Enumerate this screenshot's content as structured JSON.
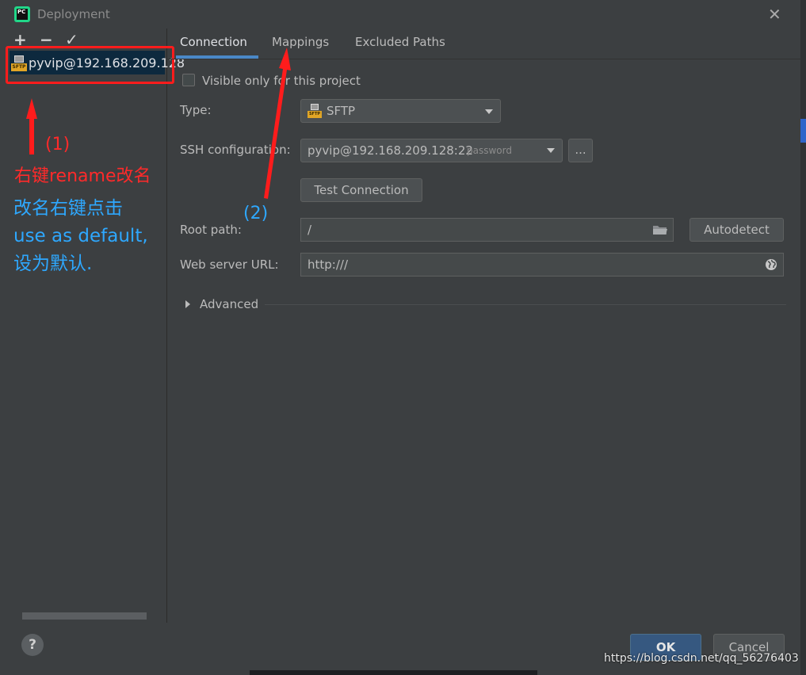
{
  "window": {
    "title": "Deployment",
    "app_icon_text": "PC"
  },
  "left_toolbar": {
    "add": "+",
    "remove": "−",
    "default": "✓"
  },
  "servers": [
    {
      "label": "pyvip@192.168.209.128",
      "badge": "SFTP"
    }
  ],
  "tabs": [
    {
      "label": "Connection",
      "active": true
    },
    {
      "label": "Mappings",
      "active": false
    },
    {
      "label": "Excluded Paths",
      "active": false
    }
  ],
  "connection": {
    "visible_only_label": "Visible only for this project",
    "visible_only_checked": false,
    "type_label": "Type:",
    "type_value": "SFTP",
    "type_badge": "SFTP",
    "ssh_label": "SSH configuration:",
    "ssh_value": "pyvip@192.168.209.128:22",
    "ssh_auth": "password",
    "ssh_more": "...",
    "test_button": "Test Connection",
    "root_label": "Root path:",
    "root_value": "/",
    "autodetect_button": "Autodetect",
    "web_label": "Web server URL:",
    "web_value": "http:///",
    "advanced_label": "Advanced"
  },
  "annotations": {
    "step1": "(1)",
    "step1_text": "右键rename改名",
    "step2": "(2)",
    "blue_line1": "改名右键点击",
    "blue_line2": "use as default,",
    "blue_line3": "设为默认."
  },
  "footer": {
    "help": "?",
    "ok": "OK",
    "cancel": "Cancel",
    "watermark": "https://blog.csdn.net/qq_56276403"
  },
  "colors": {
    "accent": "#4a88c7",
    "annotation_red": "#ff2a2a",
    "annotation_blue": "#2ea8ff",
    "ok_button": "#365880"
  }
}
